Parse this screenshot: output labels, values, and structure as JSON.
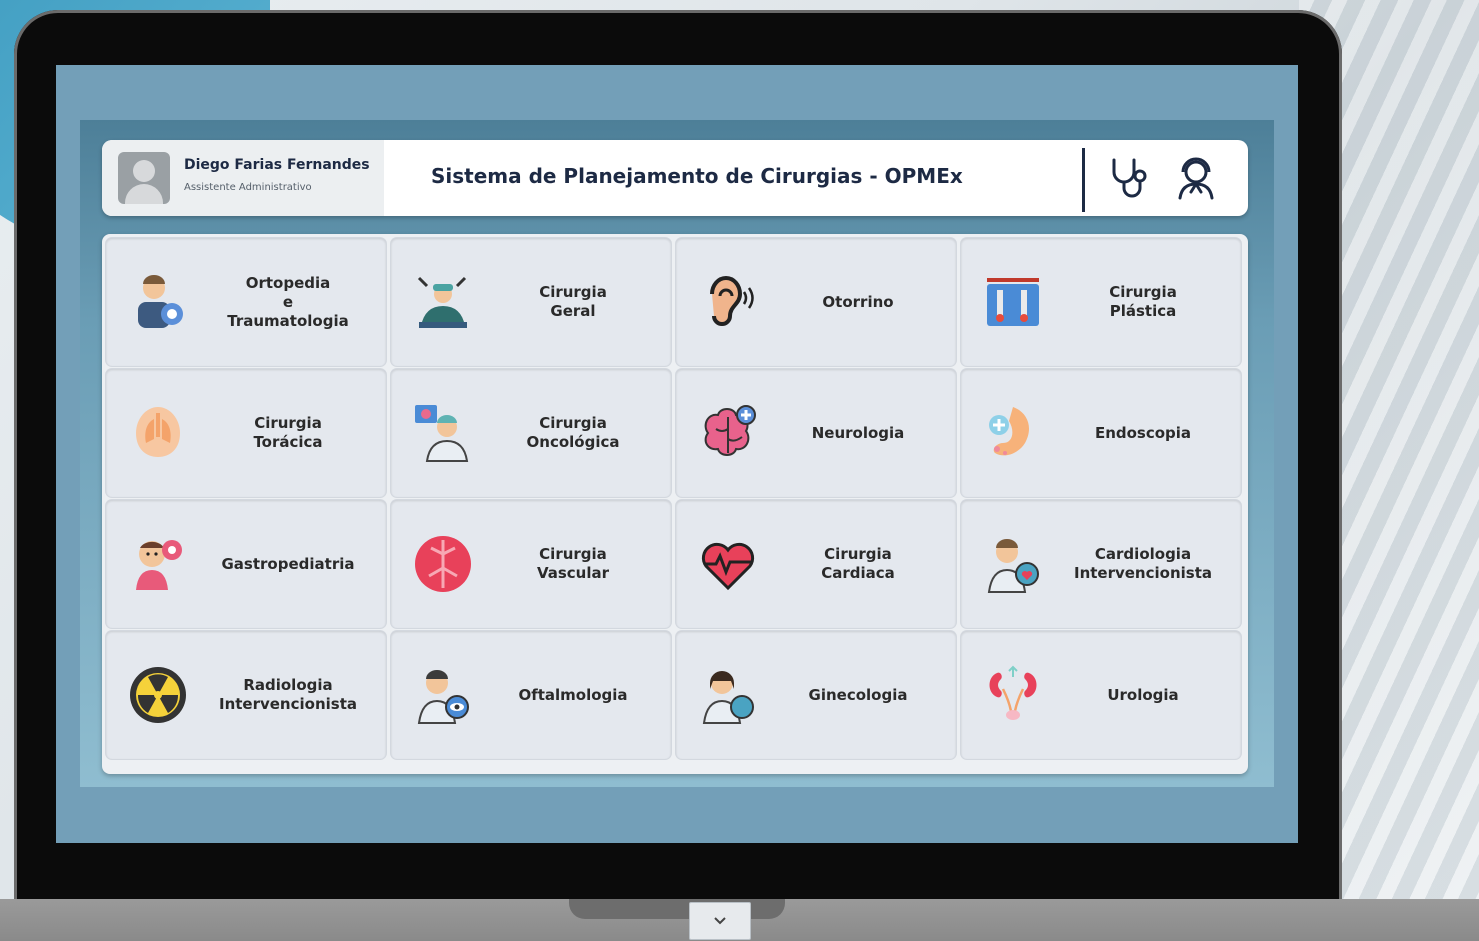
{
  "user": {
    "name": "Diego Farias Fernandes",
    "role": "Assistente Administrativo"
  },
  "header": {
    "title": "Sistema de Planejamento de Cirurgias - OPMEx",
    "icons": [
      "stethoscope-icon",
      "user-support-icon"
    ]
  },
  "specialties": [
    {
      "label": "Ortopedia\ne\nTraumatologia",
      "icon": "orthopedist-icon"
    },
    {
      "label": "Cirurgia\nGeral",
      "icon": "surgeon-icon"
    },
    {
      "label": "Otorrino",
      "icon": "ear-icon"
    },
    {
      "label": "Cirurgia\nPlástica",
      "icon": "plastic-surgery-kit-icon"
    },
    {
      "label": "Cirurgia\nTorácica",
      "icon": "lungs-icon"
    },
    {
      "label": "Cirurgia\nOncológica",
      "icon": "oncologist-icon"
    },
    {
      "label": "Neurologia",
      "icon": "brain-icon"
    },
    {
      "label": "Endoscopia",
      "icon": "stomach-icon"
    },
    {
      "label": "Gastropediatria",
      "icon": "baby-icon"
    },
    {
      "label": "Cirurgia\nVascular",
      "icon": "vascular-icon"
    },
    {
      "label": "Cirurgia\nCardiaca",
      "icon": "heart-icon"
    },
    {
      "label": "Cardiologia\nIntervencionista",
      "icon": "cardiologist-icon"
    },
    {
      "label": "Radiologia\nIntervencionista",
      "icon": "radiation-icon"
    },
    {
      "label": "Oftalmologia",
      "icon": "ophthalmologist-icon"
    },
    {
      "label": "Ginecologia",
      "icon": "gynecologist-icon"
    },
    {
      "label": "Urologia",
      "icon": "kidneys-icon"
    }
  ],
  "colors": {
    "screen_bg": "#739fb8",
    "title_text": "#1d2a44",
    "card_bg": "#e4e8ee"
  }
}
